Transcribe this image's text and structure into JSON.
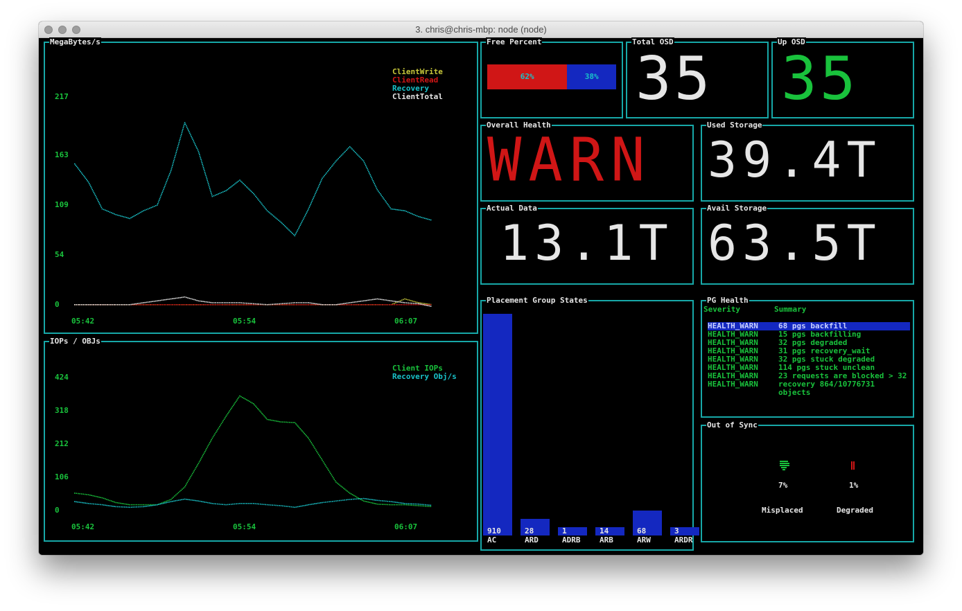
{
  "window": {
    "title": "3. chris@chris-mbp: node (node)"
  },
  "panels": {
    "megabytes": {
      "title": "MegaBytes/s",
      "legend": [
        {
          "label": "ClientWrite",
          "color": "#c8c83a"
        },
        {
          "label": "ClientRead",
          "color": "#d01616"
        },
        {
          "label": "Recovery",
          "color": "#19c2c9"
        },
        {
          "label": "ClientTotal",
          "color": "#e6e6e6"
        }
      ],
      "yticks": [
        "217",
        "163",
        "109",
        "54",
        "0"
      ],
      "xticks": [
        "05:42",
        "05:54",
        "06:07"
      ]
    },
    "iops": {
      "title": "IOPs / OBJs",
      "legend": [
        {
          "label": "Client IOPs",
          "color": "#19c23c"
        },
        {
          "label": "Recovery Obj/s",
          "color": "#19c2c9"
        }
      ],
      "yticks": [
        "424",
        "318",
        "212",
        "106",
        "0"
      ],
      "xticks": [
        "05:42",
        "05:54",
        "06:07"
      ]
    },
    "free_percent": {
      "title": "Free Percent",
      "used_label": "62%",
      "free_label": "38%",
      "used_fraction": 0.62,
      "used_color": "#d01616",
      "free_color": "#1428c0"
    },
    "total_osd": {
      "title": "Total OSD",
      "value": "35"
    },
    "up_osd": {
      "title": "Up OSD",
      "value": "35"
    },
    "overall_health": {
      "title": "Overall Health",
      "value": "WARN"
    },
    "used_storage": {
      "title": "Used Storage",
      "value": "39.4T"
    },
    "actual_data": {
      "title": "Actual Data",
      "value": "13.1T"
    },
    "avail_storage": {
      "title": "Avail Storage",
      "value": "63.5T"
    },
    "pg_states": {
      "title": "Placement Group States"
    },
    "pg_health": {
      "title": "PG Health",
      "headers": {
        "severity": "Severity",
        "summary": "Summary"
      },
      "rows": [
        {
          "severity": "HEALTH_WARN",
          "summary": "68 pgs backfill",
          "selected": true
        },
        {
          "severity": "HEALTH_WARN",
          "summary": "15 pgs backfilling"
        },
        {
          "severity": "HEALTH_WARN",
          "summary": "32 pgs degraded"
        },
        {
          "severity": "HEALTH_WARN",
          "summary": "31 pgs recovery_wait"
        },
        {
          "severity": "HEALTH_WARN",
          "summary": "32 pgs stuck degraded"
        },
        {
          "severity": "HEALTH_WARN",
          "summary": "114 pgs stuck unclean"
        },
        {
          "severity": "HEALTH_WARN",
          "summary": "23 requests are blocked > 32"
        },
        {
          "severity": "HEALTH_WARN",
          "summary": "recovery 864/10776731 objects"
        }
      ]
    },
    "out_of_sync": {
      "title": "Out of Sync",
      "gauges": [
        {
          "label": "Misplaced",
          "percent_label": "7%",
          "percent": 7,
          "color": "#19c23c"
        },
        {
          "label": "Degraded",
          "percent_label": "1%",
          "percent": 1,
          "color": "#d01616"
        }
      ]
    }
  },
  "chart_data": [
    {
      "type": "line",
      "title": "MegaBytes/s",
      "xlabel": "",
      "ylabel": "",
      "x_ticks": [
        "05:42",
        "05:54",
        "06:07"
      ],
      "ylim": [
        0,
        217
      ],
      "y_ticks": [
        0,
        54,
        109,
        163,
        217
      ],
      "grid": false,
      "legend_position": "top-right",
      "x": [
        0,
        1,
        2,
        3,
        4,
        5,
        6,
        7,
        8,
        9,
        10,
        11,
        12,
        13,
        14,
        15,
        16,
        17,
        18,
        19,
        20,
        21,
        22,
        23,
        24,
        25,
        26
      ],
      "series": [
        {
          "name": "ClientWrite",
          "color": "#c8c83a",
          "values": [
            0,
            0,
            0,
            0,
            0,
            0,
            0,
            0,
            0,
            0,
            0,
            0,
            0,
            0,
            0,
            0,
            0,
            0,
            0,
            0,
            0,
            0,
            0,
            0,
            6,
            2,
            0
          ]
        },
        {
          "name": "ClientRead",
          "color": "#d01616",
          "values": [
            0,
            0,
            0,
            0,
            0,
            0,
            0,
            0,
            0,
            0,
            0,
            0,
            0,
            0,
            0,
            0,
            0,
            0,
            0,
            0,
            0,
            0,
            0,
            0,
            0,
            0,
            0
          ]
        },
        {
          "name": "Recovery",
          "color": "#19c2c9",
          "values": [
            147,
            128,
            100,
            94,
            90,
            98,
            104,
            140,
            190,
            160,
            113,
            119,
            130,
            116,
            98,
            86,
            72,
            100,
            132,
            150,
            165,
            150,
            120,
            100,
            98,
            92,
            88
          ]
        },
        {
          "name": "ClientTotal",
          "color": "#e6e6e6",
          "values": [
            0,
            0,
            0,
            0,
            0,
            2,
            4,
            6,
            8,
            4,
            2,
            2,
            2,
            1,
            0,
            1,
            2,
            2,
            0,
            0,
            2,
            4,
            6,
            4,
            2,
            1,
            -2
          ]
        }
      ]
    },
    {
      "type": "line",
      "title": "IOPs / OBJs",
      "xlabel": "",
      "ylabel": "",
      "x_ticks": [
        "05:42",
        "05:54",
        "06:07"
      ],
      "ylim": [
        0,
        424
      ],
      "y_ticks": [
        0,
        106,
        212,
        318,
        424
      ],
      "grid": false,
      "legend_position": "top-right",
      "x": [
        0,
        1,
        2,
        3,
        4,
        5,
        6,
        7,
        8,
        9,
        10,
        11,
        12,
        13,
        14,
        15,
        16,
        17,
        18,
        19,
        20,
        21,
        22,
        23,
        24,
        25,
        26
      ],
      "series": [
        {
          "name": "Client IOPs",
          "color": "#19c23c",
          "values": [
            55,
            50,
            40,
            25,
            18,
            18,
            18,
            35,
            75,
            150,
            230,
            300,
            365,
            340,
            290,
            282,
            280,
            230,
            160,
            90,
            55,
            30,
            20,
            18,
            18,
            15,
            12
          ]
        },
        {
          "name": "Recovery Obj/s",
          "color": "#19c2c9",
          "values": [
            28,
            22,
            18,
            12,
            10,
            12,
            18,
            28,
            36,
            30,
            22,
            18,
            22,
            22,
            18,
            15,
            10,
            18,
            25,
            30,
            35,
            38,
            32,
            28,
            22,
            20,
            16
          ]
        }
      ]
    },
    {
      "type": "bar",
      "title": "Placement Group States",
      "categories": [
        "AC",
        "ARD",
        "ADRB",
        "ARB",
        "ARW",
        "ARDR"
      ],
      "values": [
        910,
        28,
        1,
        14,
        68,
        3
      ],
      "bar_color": "#1428c0",
      "ylim": [
        0,
        910
      ]
    }
  ]
}
